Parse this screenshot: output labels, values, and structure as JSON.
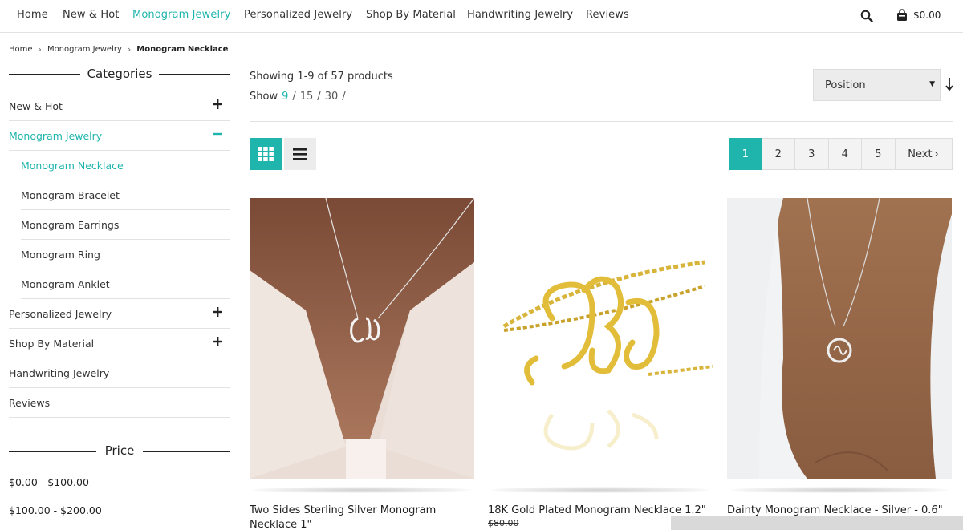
{
  "nav": {
    "items": [
      {
        "label": "Home",
        "active": false
      },
      {
        "label": "New & Hot",
        "active": false
      },
      {
        "label": "Monogram Jewelry",
        "active": true
      },
      {
        "label": "Personalized Jewelry",
        "active": false
      },
      {
        "label": "Shop By Material",
        "active": false
      },
      {
        "label": "Handwriting Jewelry",
        "active": false
      },
      {
        "label": "Reviews",
        "active": false
      }
    ],
    "search_icon": "search-icon",
    "cart_icon": "shopping-bag-icon",
    "cart_total": "$0.00"
  },
  "breadcrumb": {
    "items": [
      "Home",
      "Monogram Jewelry"
    ],
    "current": "Monogram Necklace"
  },
  "sidebar": {
    "categories_title": "Categories",
    "categories": [
      {
        "label": "New & Hot",
        "toggle": "plus"
      },
      {
        "label": "Monogram Jewelry",
        "toggle": "minus",
        "active": true
      },
      {
        "label": "Monogram Necklace",
        "sub": true,
        "active": true
      },
      {
        "label": "Monogram Bracelet",
        "sub": true
      },
      {
        "label": "Monogram Earrings",
        "sub": true
      },
      {
        "label": "Monogram Ring",
        "sub": true
      },
      {
        "label": "Monogram Anklet",
        "sub": true
      },
      {
        "label": "Personalized Jewelry",
        "toggle": "plus"
      },
      {
        "label": "Shop By Material",
        "toggle": "plus"
      },
      {
        "label": "Handwriting Jewelry"
      },
      {
        "label": "Reviews"
      }
    ],
    "price_title": "Price",
    "prices": [
      "$0.00 - $100.00",
      "$100.00 - $200.00"
    ]
  },
  "toolbar": {
    "showing": "Showing 1-9 of 57 products",
    "show_label": "Show",
    "show_options": [
      "9",
      "15",
      "30"
    ],
    "show_active": "9",
    "sort_value": "Position",
    "sort_dir_icon": "sort-descending-icon",
    "grid_icon": "grid-view-icon",
    "list_icon": "list-view-icon"
  },
  "pager": {
    "pages": [
      "1",
      "2",
      "3",
      "4",
      "5"
    ],
    "active": "1",
    "next_label": "Next"
  },
  "products": [
    {
      "name": "Two Sides Sterling Silver Monogram Necklace 1\"",
      "old_price": ""
    },
    {
      "name": "18K Gold Plated Monogram Necklace 1.2\"",
      "old_price": "$80.00"
    },
    {
      "name": "Dainty Monogram Necklace - Silver - 0.6\"",
      "old_price": ""
    }
  ],
  "colors": {
    "accent": "#1fb5ac",
    "text": "#222222",
    "divider": "#e2e2e2",
    "button_bg": "#ececec"
  }
}
